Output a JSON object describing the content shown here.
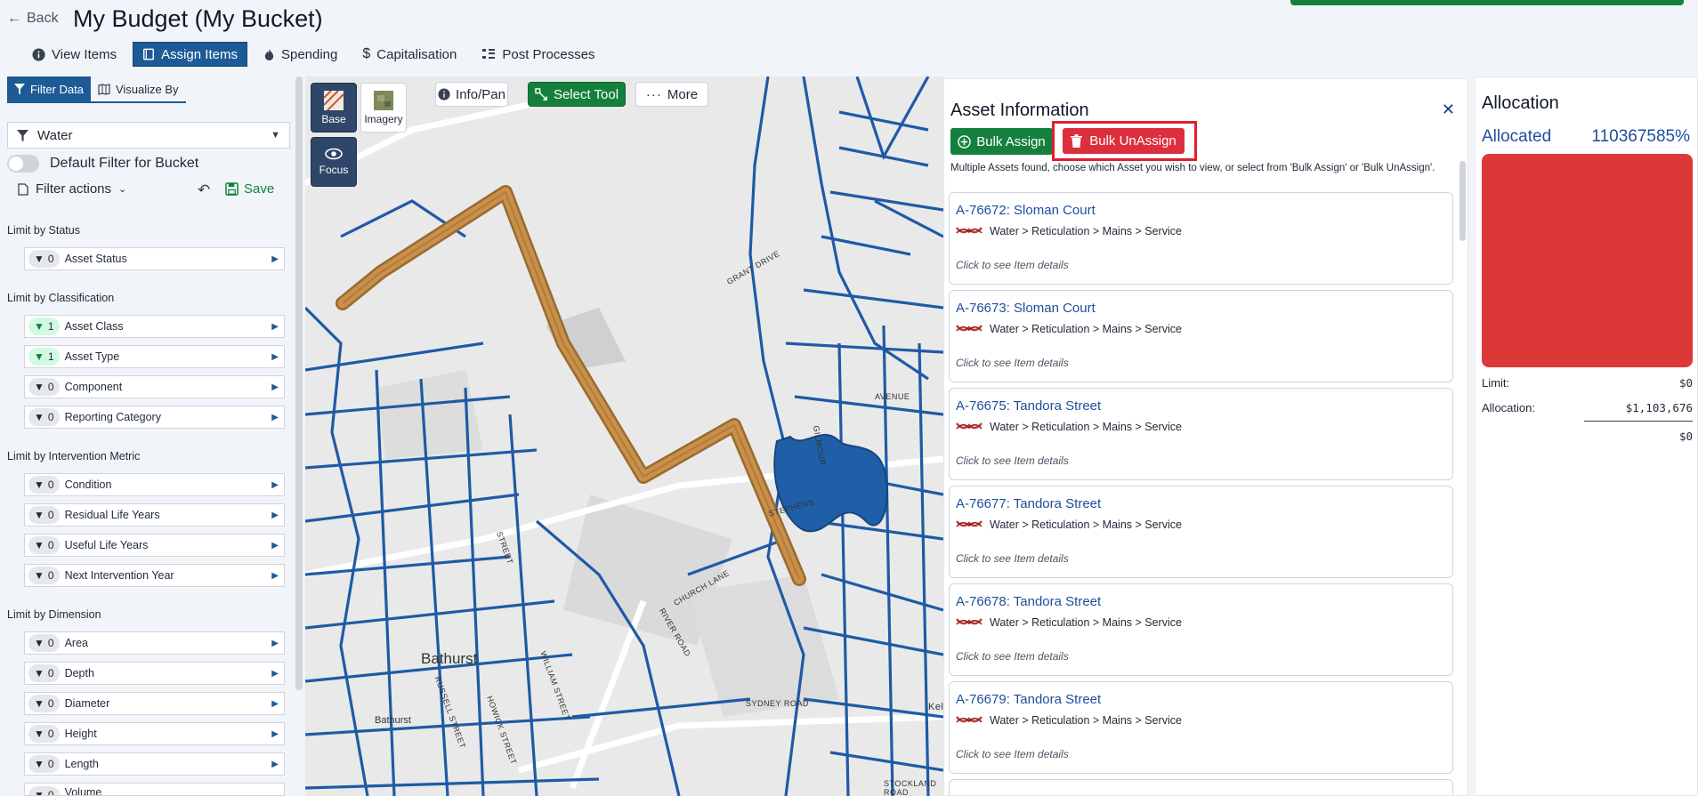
{
  "header": {
    "back_label": "Back",
    "title": "My Budget (My Bucket)"
  },
  "tabs": [
    {
      "label": "View Items",
      "icon": "info-icon"
    },
    {
      "label": "Assign Items",
      "icon": "book-icon"
    },
    {
      "label": "Spending",
      "icon": "flame-icon"
    },
    {
      "label": "Capitalisation",
      "icon": "dollar-icon"
    },
    {
      "label": "Post Processes",
      "icon": "process-icon"
    }
  ],
  "sidebar": {
    "tabs": [
      {
        "label": "Filter Data"
      },
      {
        "label": "Visualize By"
      }
    ],
    "selected_network": "Water",
    "default_filter_label": "Default Filter for Bucket",
    "filter_actions_label": "Filter actions",
    "save_label": "Save",
    "groups": [
      {
        "label": "Limit by Status",
        "filters": [
          {
            "count": "0",
            "label": "Asset Status",
            "active": false
          }
        ]
      },
      {
        "label": "Limit by Classification",
        "filters": [
          {
            "count": "1",
            "label": "Asset Class",
            "active": true
          },
          {
            "count": "1",
            "label": "Asset Type",
            "active": true
          },
          {
            "count": "0",
            "label": "Component",
            "active": false
          },
          {
            "count": "0",
            "label": "Reporting Category",
            "active": false
          }
        ]
      },
      {
        "label": "Limit by Intervention Metric",
        "filters": [
          {
            "count": "0",
            "label": "Condition",
            "active": false
          },
          {
            "count": "0",
            "label": "Residual Life Years",
            "active": false
          },
          {
            "count": "0",
            "label": "Useful Life Years",
            "active": false
          },
          {
            "count": "0",
            "label": "Next Intervention Year",
            "active": false
          }
        ]
      },
      {
        "label": "Limit by Dimension",
        "filters": [
          {
            "count": "0",
            "label": "Area",
            "active": false
          },
          {
            "count": "0",
            "label": "Depth",
            "active": false
          },
          {
            "count": "0",
            "label": "Diameter",
            "active": false
          },
          {
            "count": "0",
            "label": "Height",
            "active": false
          },
          {
            "count": "0",
            "label": "Length",
            "active": false
          },
          {
            "count": "0",
            "label": "Volume",
            "active": false
          }
        ]
      }
    ]
  },
  "map": {
    "tools": {
      "base": "Base",
      "imagery": "Imagery",
      "focus": "Focus",
      "info_pan": "Info/Pan",
      "select_tool": "Select Tool",
      "more": "More"
    },
    "labels": [
      "Bathurst",
      "Bathurst",
      "SYDNEY ROAD",
      "CHURCH LANE",
      "STEPHENS",
      "RIVER ROAD",
      "GRANT DRIVE",
      "STREET",
      "RUSSELL STREET",
      "HOWICK STREET",
      "WILLIAM STREET",
      "STOCKLAND ROAD",
      "AVENUE",
      "GILMOUR",
      "Kel"
    ]
  },
  "asset_panel": {
    "title": "Asset Information",
    "bulk_assign_label": "Bulk Assign",
    "bulk_unassign_label": "Bulk UnAssign",
    "message": "Multiple Assets found, choose which Asset you wish to view, or select from 'Bulk Assign' or 'Bulk UnAssign'.",
    "click_hint": "Click to see Item details",
    "assets": [
      {
        "id": "A-76672: Sloman Court",
        "path": "Water > Reticulation > Mains > Service"
      },
      {
        "id": "A-76673: Sloman Court",
        "path": "Water > Reticulation > Mains > Service"
      },
      {
        "id": "A-76675: Tandora Street",
        "path": "Water > Reticulation > Mains > Service"
      },
      {
        "id": "A-76677: Tandora Street",
        "path": "Water > Reticulation > Mains > Service"
      },
      {
        "id": "A-76678: Tandora Street",
        "path": "Water > Reticulation > Mains > Service"
      },
      {
        "id": "A-76679: Tandora Street",
        "path": "Water > Reticulation > Mains > Service"
      }
    ]
  },
  "allocation": {
    "title": "Allocation",
    "allocated_label": "Allocated",
    "allocated_percent": "110367585%",
    "limit_label": "Limit:",
    "limit_value": "$0",
    "allocation_label": "Allocation:",
    "allocation_value": "$1,103,676",
    "remaining_value": "$0",
    "bar_color": "#dc3838"
  },
  "colors": {
    "accent": "#1e5a96",
    "success": "#15803d",
    "danger": "#dc2f3d",
    "pipe": "#1f5aa6",
    "selection": "#c0823a"
  }
}
